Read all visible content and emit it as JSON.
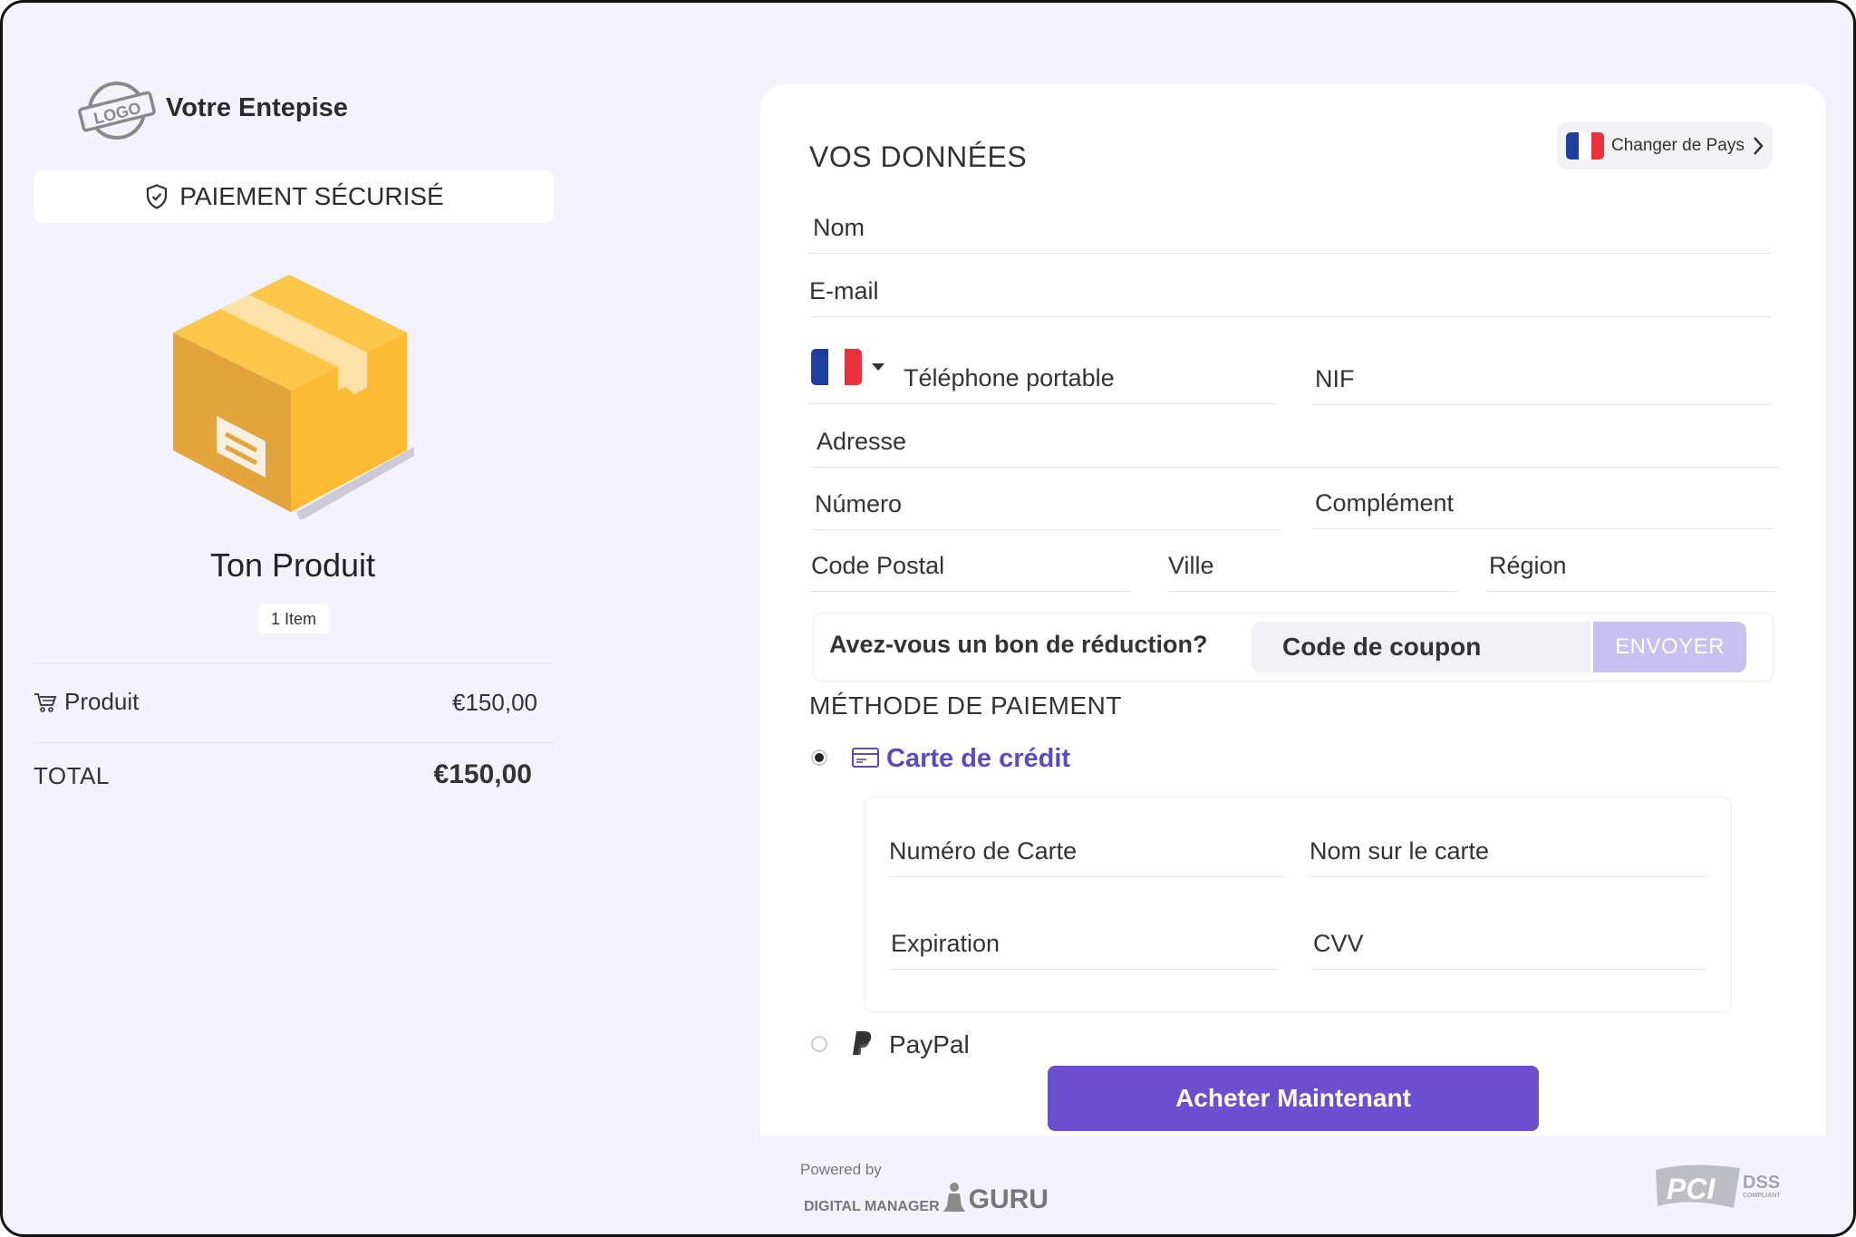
{
  "brand": {
    "logo_text": "LOGO",
    "company_name": "Votre Entepise",
    "secure_label": "PAIEMENT SÉCURISÉ"
  },
  "product": {
    "title": "Ton Produit",
    "badge": "1 Item",
    "line_label": "Produit",
    "line_value": "€150,00",
    "total_label": "TOTAL",
    "total_value": "€150,00"
  },
  "form": {
    "title": "VOS DONNÉES",
    "change_country": "Changer de Pays",
    "fields": {
      "nom": "Nom",
      "email": "E-mail",
      "phone": "Téléphone portable",
      "nif": "NIF",
      "adresse": "Adresse",
      "numero": "Número",
      "complement": "Complément",
      "code_postal": "Code Postal",
      "ville": "Ville",
      "region": "Région"
    },
    "coupon": {
      "question": "Avez-vous un bon de réduction?",
      "placeholder": "Code de coupon",
      "button": "ENVOYER"
    }
  },
  "payment": {
    "title": "MÉTHODE DE PAIEMENT",
    "credit_card": "Carte de crédit",
    "card_number": "Numéro de Carte",
    "card_name": "Nom sur le carte",
    "expiration": "Expiration",
    "cvv": "CVV",
    "paypal": "PayPal",
    "buy_button": "Acheter Maintenant"
  },
  "footer": {
    "powered_by": "Powered by",
    "dmg_small": "DIGITAL MANAGER",
    "dmg_big": "GURU",
    "pci_text": "PCI",
    "dss_text": "DSS",
    "compliant_text": "COMPLIANT"
  },
  "colors": {
    "accent": "#6a4fcf",
    "accent_light": "#c9c0f2",
    "background": "#f4f2fd",
    "flag_blue": "#1c3fa0",
    "flag_red": "#e8323c"
  }
}
